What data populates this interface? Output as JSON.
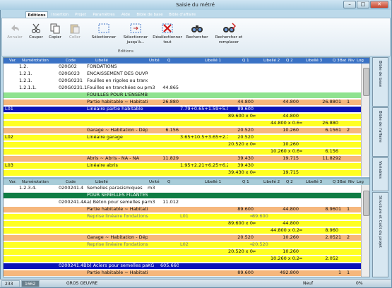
{
  "window": {
    "title": "Saisie du métré",
    "controls": [
      "–",
      "□",
      "✕"
    ]
  },
  "tabs": [
    "Editions",
    "Insertion",
    "Projet",
    "Paramètres",
    "Aide",
    "Bible de base",
    "Bible d'affaire"
  ],
  "ribbon": {
    "buttons": [
      "Annuler",
      "Couper",
      "Copier",
      "Coller",
      "Sélectionner",
      "Sélectionner jusqu'à...",
      "Désélectionner tout",
      "Rechercher",
      "Rechercher et remplacer"
    ],
    "group_label": "Editions"
  },
  "top_header": [
    "Var.",
    "Numérotation",
    "Code",
    "Libellé",
    "Unité",
    "Q",
    "Libellé 1",
    "Q 1",
    "Libellé 2",
    "Q 2",
    "Libellé 3",
    "Q 3",
    "Bat",
    "Niv",
    "Log"
  ],
  "top_rows": [
    {
      "bg": "#ffffff",
      "fg": "#111",
      "cells": [
        "",
        "1.2.",
        "020G02",
        "FONDATIONS",
        "",
        "",
        "",
        "",
        "",
        "",
        "",
        "",
        "",
        "",
        ""
      ]
    },
    {
      "bg": "#ffffff",
      "fg": "#111",
      "cells": [
        "",
        "1.2.1.",
        "020G023",
        "ENCAISSEMENT DES OUVRAGES",
        "",
        "",
        "",
        "",
        "",
        "",
        "",
        "",
        "",
        "",
        ""
      ]
    },
    {
      "bg": "#ffffff",
      "fg": "#111",
      "cells": [
        "",
        "1.2.1.",
        "020G0231",
        "Fouilles en rigoles ou tranchées",
        "",
        "",
        "",
        "",
        "",
        "",
        "",
        "",
        "",
        "",
        ""
      ]
    },
    {
      "bg": "#ffffff",
      "fg": "#111",
      "cells": [
        "",
        "1.2.1.1.",
        "020G0231.1",
        "Fouilles en tranchées ou ponctuelle",
        "m3",
        "44.865",
        "",
        "",
        "",
        "",
        "",
        "",
        "",
        "",
        ""
      ]
    },
    {
      "bg": "#8fe28f",
      "fg": "#111",
      "cells": [
        "",
        "",
        "",
        "FOUILLES POUR L'ENSEMBLE DES !",
        "",
        "",
        "",
        "",
        "",
        "",
        "",
        "",
        "",
        "",
        ""
      ]
    },
    {
      "bg": "#f6b77c",
      "fg": "#111",
      "cells": [
        "",
        "",
        "",
        "Partie habitable ~ Habitation - Par",
        "",
        "26.880",
        "",
        "44.800",
        "",
        "44.800",
        "",
        "26.880",
        "1",
        "1",
        ""
      ]
    },
    {
      "bg": "#0b14b8",
      "fg": "#ffffff",
      "cells": [
        "L01",
        "",
        "",
        "Linéaire partie habitable",
        "",
        "",
        "7.79+0.65+1.59+5.04+1=",
        "89.600",
        "",
        "",
        "",
        "",
        "",
        "",
        ""
      ]
    },
    {
      "bg": "#ffff22",
      "fg": "#111",
      "cells": [
        "",
        "",
        "",
        "",
        "",
        "",
        "",
        "89.600 x 0.50",
        "=",
        "44.800",
        "",
        "",
        "",
        "",
        ""
      ]
    },
    {
      "bg": "#ffff22",
      "fg": "#111",
      "cells": [
        "",
        "",
        "",
        "",
        "",
        "",
        "",
        "",
        "",
        "44.800 x 0.60",
        "=",
        "26.880",
        "",
        "",
        ""
      ]
    },
    {
      "bg": "#f6b77c",
      "fg": "#111",
      "cells": [
        "",
        "",
        "",
        "Garage ~ Habitation - Dépendanc",
        "",
        "6.156",
        "",
        "20.520",
        "",
        "10.260",
        "",
        "6.156",
        "1",
        "2",
        ""
      ]
    },
    {
      "bg": "#ffff22",
      "fg": "#111",
      "cells": [
        "L02",
        "",
        "",
        "Linéaire garage",
        "",
        "",
        "3.65+10.5+3.65+2.72 =",
        "20.520",
        "",
        "",
        "",
        "",
        "",
        "",
        ""
      ]
    },
    {
      "bg": "#ffff22",
      "fg": "#111",
      "cells": [
        "",
        "",
        "",
        "",
        "",
        "",
        "",
        "20.520 x 0.50",
        "=",
        "10.260",
        "",
        "",
        "",
        "",
        ""
      ]
    },
    {
      "bg": "#ffff22",
      "fg": "#111",
      "cells": [
        "",
        "",
        "",
        "",
        "",
        "",
        "",
        "",
        "",
        "10.260 x 0.60",
        "=",
        "6.156",
        "",
        "",
        ""
      ]
    },
    {
      "bg": "#f6b77c",
      "fg": "#111",
      "cells": [
        "",
        "",
        "",
        "Abris ~ Abris - NA - NA",
        "",
        "11.829",
        "",
        "39.430",
        "",
        "19.715",
        "",
        "11.829",
        "2",
        "",
        ""
      ]
    },
    {
      "bg": "#ffff22",
      "fg": "#111",
      "cells": [
        "L03",
        "",
        "",
        "Linéaire abris",
        "",
        "",
        "1.95+2.21+6.25+6.25+2=",
        "39.430",
        "",
        "",
        "",
        "",
        "",
        "",
        ""
      ]
    },
    {
      "bg": "#ffff22",
      "fg": "#111",
      "cells": [
        "",
        "",
        "",
        "",
        "",
        "",
        "",
        "39.430 x 0.50",
        "=",
        "19.715",
        "",
        "",
        "",
        "",
        ""
      ]
    }
  ],
  "bottom_header": [
    "Var.",
    "Numérotation",
    "Code",
    "Libellé",
    "Unité",
    "Q",
    "Libellé 1",
    "Q 1",
    "Libellé 2",
    "Q 2",
    "Libellé 3",
    "Q 3",
    "Bat",
    "Niv",
    "Log"
  ],
  "bottom_rows": [
    {
      "bg": "#ffffff",
      "fg": "#111",
      "cells": [
        "",
        "1.2.3.4.",
        "0200241.4",
        "Semelles parasismiques",
        "m3",
        "",
        "",
        "",
        "",
        "",
        "",
        "",
        "",
        "",
        ""
      ]
    },
    {
      "bg": "#0f7d44",
      "fg": "#ffffff",
      "cells": [
        "",
        "",
        "",
        "POUR SEMELLES FILANTES HABI",
        "",
        "",
        "",
        "",
        "",
        "",
        "",
        "",
        "",
        "",
        ""
      ]
    },
    {
      "bg": "#ffffff",
      "fg": "#111",
      "cells": [
        "",
        "",
        "0200241.4A",
        "a) Béton pour semelles parasism",
        "m3",
        "11.012",
        "",
        "",
        "",
        "",
        "",
        "",
        "",
        "",
        ""
      ]
    },
    {
      "bg": "#f6b77c",
      "fg": "#111",
      "cells": [
        "",
        "",
        "",
        "Partie habitable ~ Habitation - P",
        "",
        "",
        "",
        "89.600",
        "",
        "44.800",
        "",
        "8.960",
        "1",
        "1",
        ""
      ]
    },
    {
      "bg": "#ffff22",
      "fg": "#777",
      "cells": [
        "",
        "",
        "",
        "Reprise linéaire fondations parti",
        "",
        "",
        "L01",
        "=",
        "89.600",
        "",
        "",
        "",
        "",
        "",
        ""
      ]
    },
    {
      "bg": "#ffff22",
      "fg": "#111",
      "cells": [
        "",
        "",
        "",
        "",
        "",
        "",
        "",
        "89.600 x 0.50",
        "=",
        "44.800",
        "",
        "",
        "",
        "",
        ""
      ]
    },
    {
      "bg": "#ffff22",
      "fg": "#111",
      "cells": [
        "",
        "",
        "",
        "",
        "",
        "",
        "",
        "",
        "",
        "44.800 x 0.20",
        "=",
        "8.960",
        "",
        "",
        ""
      ]
    },
    {
      "bg": "#f6b77c",
      "fg": "#111",
      "cells": [
        "",
        "",
        "",
        "Garage ~ Habitation - Dépendar",
        "",
        "",
        "",
        "20.520",
        "",
        "10.260",
        "",
        "2.052",
        "1",
        "2",
        ""
      ]
    },
    {
      "bg": "#ffff22",
      "fg": "#777",
      "cells": [
        "",
        "",
        "",
        "Reprise linéaire fondations gara",
        "",
        "",
        "L02",
        "=",
        "20.520",
        "",
        "",
        "",
        "",
        "",
        ""
      ]
    },
    {
      "bg": "#ffff22",
      "fg": "#111",
      "cells": [
        "",
        "",
        "",
        "",
        "",
        "",
        "",
        "20.520 x 0.50",
        "=",
        "10.260",
        "",
        "",
        "",
        "",
        ""
      ]
    },
    {
      "bg": "#ffff22",
      "fg": "#111",
      "cells": [
        "",
        "",
        "",
        "",
        "",
        "",
        "",
        "",
        "",
        "10.260 x 0.20",
        "=",
        "2.052",
        "",
        "",
        ""
      ]
    },
    {
      "bg": "#0b14b8",
      "fg": "#ffffff",
      "cells": [
        "",
        "",
        "0200241.4B",
        "b) Aciers pour semelles parasism",
        "KG",
        "605.660",
        "",
        "",
        "",
        "",
        "",
        "",
        "",
        "",
        ""
      ]
    },
    {
      "bg": "#f6b77c",
      "fg": "#111",
      "cells": [
        "",
        "",
        "",
        "Partie habitable ~ Habitation - P",
        "",
        "",
        "",
        "89.600",
        "",
        "492.800",
        "",
        "",
        "1",
        "1",
        ""
      ]
    },
    {
      "bg": "#ffff22",
      "fg": "#777",
      "cells": [
        "",
        "",
        "",
        "Reprise linéaire fondations parti",
        "",
        "",
        "L01",
        "=",
        "89.600",
        "",
        "",
        "",
        "",
        "",
        ""
      ]
    },
    {
      "bg": "#ffff22",
      "fg": "#111",
      "cells": [
        "",
        "",
        "",
        "",
        "",
        "",
        "",
        "89.600 x 5.50",
        "=",
        "492.800",
        "",
        "",
        "",
        "",
        ""
      ]
    }
  ],
  "side_tabs": [
    "Bible de base",
    "Bible de l'affaire",
    "Variables",
    "Structure et Coût du projet"
  ],
  "status": {
    "left1": "233",
    "left2": "1662",
    "section": "GROS OEUVRE",
    "state": "Neuf",
    "percent": "0%"
  },
  "colors": {
    "header_blue": "#3a72c5",
    "selected_blue": "#0b14b8",
    "yellow": "#ffff22",
    "orange": "#f6b77c",
    "green_light": "#8fe28f",
    "green_dark": "#0f7d44"
  }
}
